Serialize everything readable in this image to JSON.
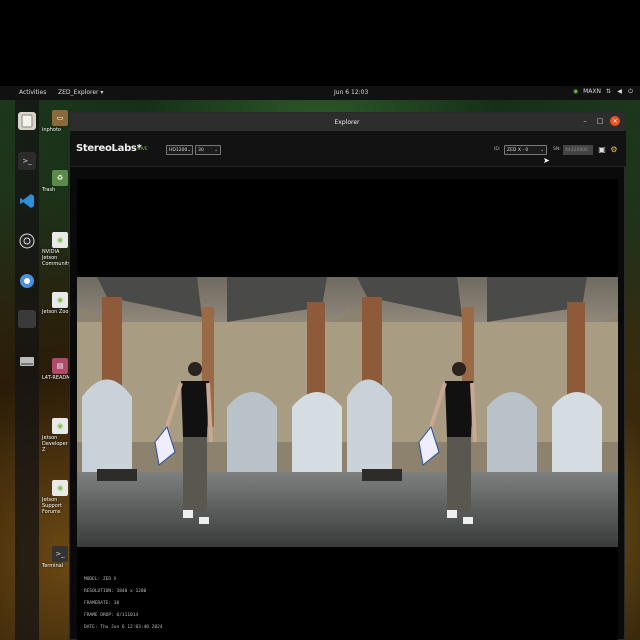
{
  "topbar": {
    "activities": "Activities",
    "app_menu": "ZED_Explorer ▾",
    "clock": "Jun 6 12:03",
    "tray_mode": "MAXN",
    "icons": [
      "nvidia-icon",
      "network-icon",
      "volume-icon",
      "power-icon",
      "menu-icon"
    ]
  },
  "dock": {
    "items": [
      "files-icon",
      "terminal-icon",
      "vscode-icon",
      "obs-icon",
      "chromium-icon",
      "blank-app-icon",
      "drive-icon"
    ]
  },
  "desktop": {
    "icons": [
      {
        "label": "inphoto",
        "icon": "folder-icon"
      },
      {
        "label": "Trash",
        "icon": "trash-icon"
      },
      {
        "label": "NVIDIA Jetson Community",
        "icon": "nvidia-link-icon"
      },
      {
        "label": "Jetson Zoo",
        "icon": "nvidia-link-icon"
      },
      {
        "label": "L4T-README",
        "icon": "drive-icon"
      },
      {
        "label": "Jetson Developer Z",
        "icon": "nvidia-link-icon"
      },
      {
        "label": "Jetson Support Forums",
        "icon": "nvidia-link-icon"
      },
      {
        "label": "Terminal",
        "icon": "terminal-icon"
      }
    ]
  },
  "window": {
    "title": "Explorer",
    "logo": "StereoLabs*",
    "live_label": "LIVE",
    "resolution_select": "HD1200",
    "fps_select": "30",
    "id_label": "ID:",
    "id_select": "ZED X - 0",
    "sn_label": "SN:",
    "sn_value": "44320806"
  },
  "info": {
    "model": "MODEL: ZED X",
    "resolution": "RESOLUTION: 3840 x 1200",
    "framerate": "FRAMERATE: 30",
    "frame_drop": "FRAME DROP: 0/111014",
    "date": "DATE: Thu Jun 6 12:03:40 2024"
  },
  "colors": {
    "accent_green": "#7ac142",
    "close_button": "#e95420"
  }
}
